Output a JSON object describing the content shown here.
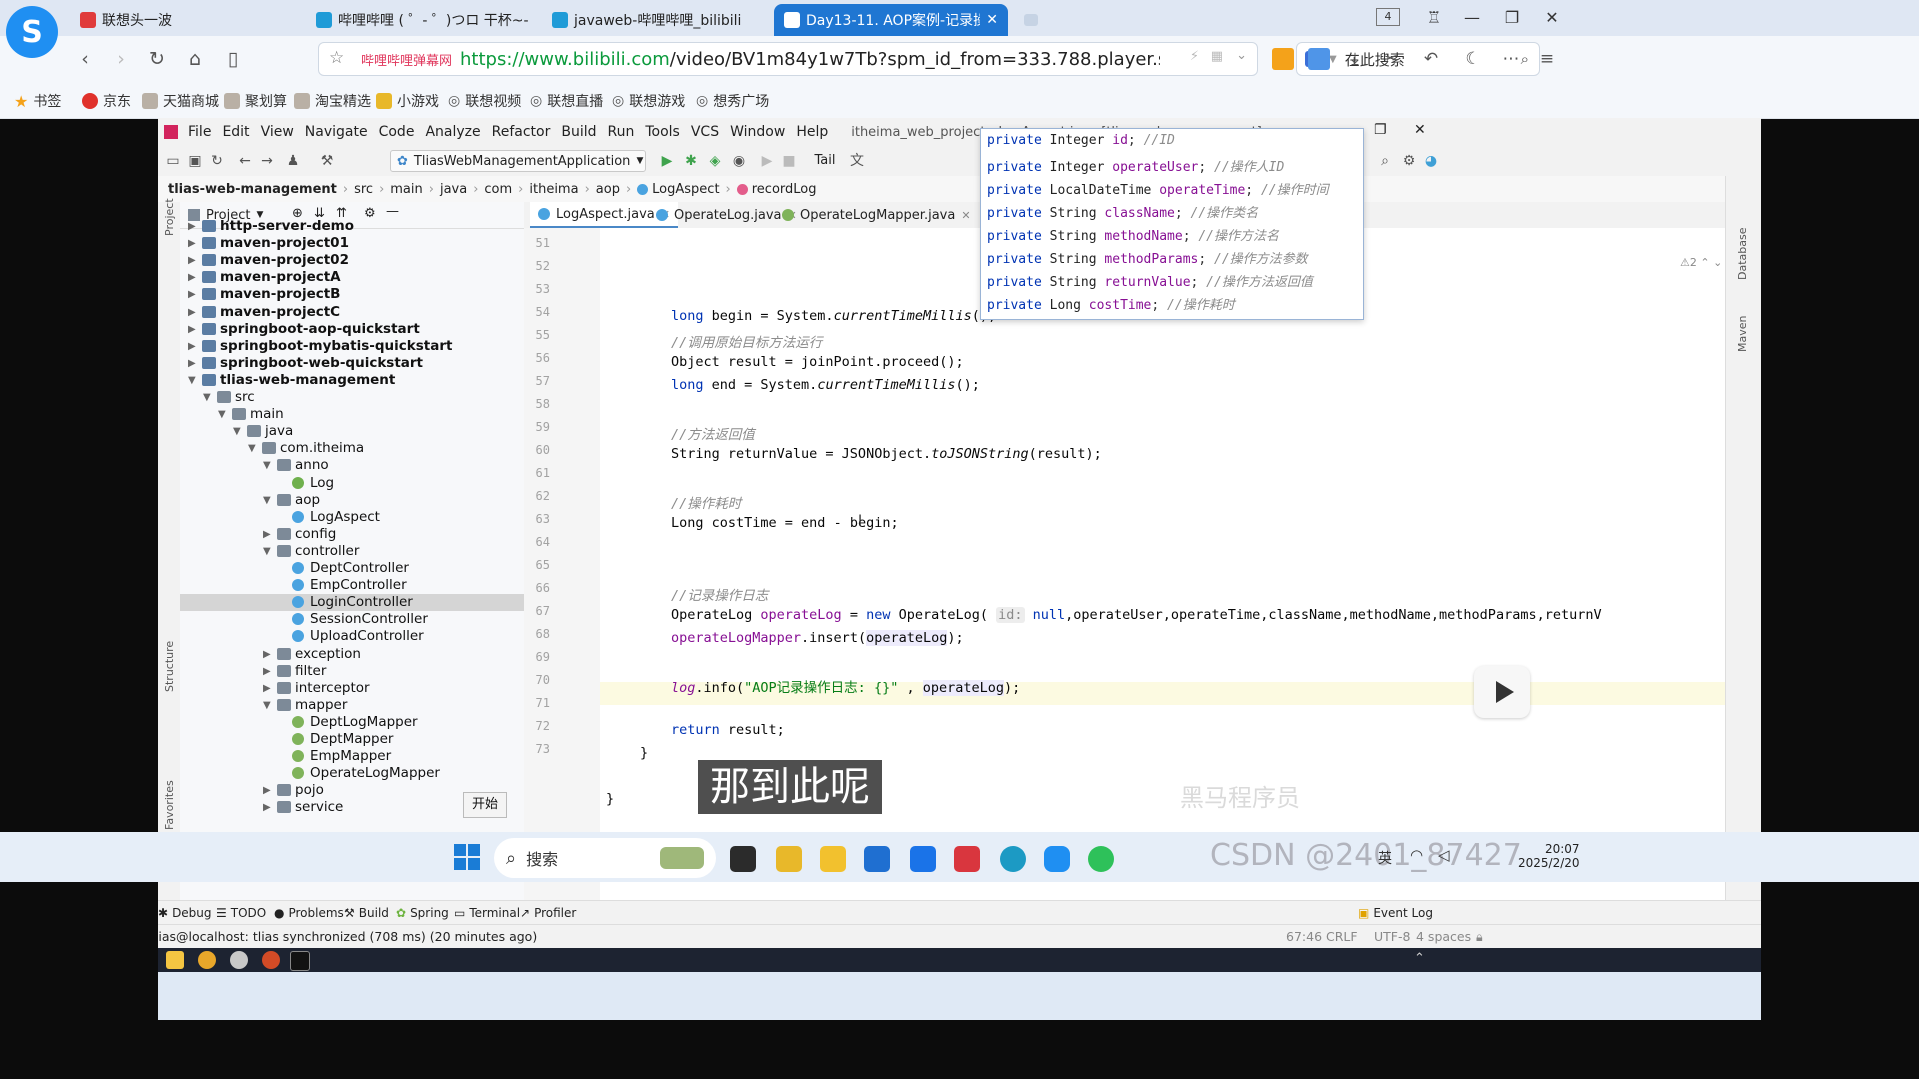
{
  "browser": {
    "tabs": [
      {
        "label": "联想头一波"
      },
      {
        "label": "哔哩哔哩 ( ゜- ゜)つロ 干杯~-bilib"
      },
      {
        "label": "javaweb-哔哩哔哩_bilibili"
      },
      {
        "label": "Day13-11. AOP案例-记录操作",
        "active": true
      }
    ],
    "tab_count": "4",
    "url_badge": "哔哩哔哩弹幕网",
    "url_scheme_host": "https://www.bilibili.com",
    "url_path": "/video/BV1m84y1w7Tb?spm_id_from=333.788.player.switcl",
    "search_placeholder": "在此搜索",
    "bookmarks": [
      "书签",
      "京东",
      "天猫商城",
      "聚划算",
      "淘宝精选",
      "小游戏",
      "联想视频",
      "联想直播",
      "联想游戏",
      "想秀广场"
    ]
  },
  "ide": {
    "menus": [
      "File",
      "Edit",
      "View",
      "Navigate",
      "Code",
      "Analyze",
      "Refactor",
      "Build",
      "Run",
      "Tools",
      "VCS",
      "Window",
      "Help"
    ],
    "window_title": "itheima_web_project - LogAspect.java [tlias-web-management]",
    "run_config": "TliasWebManagementApplication",
    "tail_label": "Tail",
    "breadcrumb": [
      "tlias-web-management",
      "src",
      "main",
      "java",
      "com",
      "itheima",
      "aop",
      "LogAspect",
      "recordLog"
    ],
    "project_label": "Project",
    "side_labels": {
      "project": "Project",
      "structure": "Structure",
      "favorites": "Favorites",
      "database": "Database",
      "maven": "Maven"
    },
    "tree": [
      {
        "label": "http-server-demo",
        "bold": true
      },
      {
        "label": "maven-project01",
        "bold": true
      },
      {
        "label": "maven-project02",
        "bold": true
      },
      {
        "label": "maven-projectA",
        "bold": true
      },
      {
        "label": "maven-projectB",
        "bold": true
      },
      {
        "label": "maven-projectC",
        "bold": true
      },
      {
        "label": "springboot-aop-quickstart",
        "bold": true
      },
      {
        "label": "springboot-mybatis-quickstart",
        "bold": true
      },
      {
        "label": "springboot-web-quickstart",
        "bold": true
      },
      {
        "label": "tlias-web-management",
        "bold": true
      },
      {
        "label": "src"
      },
      {
        "label": "main"
      },
      {
        "label": "java"
      },
      {
        "label": "com.itheima"
      },
      {
        "label": "anno"
      },
      {
        "label": "Log"
      },
      {
        "label": "aop"
      },
      {
        "label": "LogAspect"
      },
      {
        "label": "config"
      },
      {
        "label": "controller"
      },
      {
        "label": "DeptController"
      },
      {
        "label": "EmpController"
      },
      {
        "label": "LoginController"
      },
      {
        "label": "SessionController"
      },
      {
        "label": "UploadController"
      },
      {
        "label": "exception"
      },
      {
        "label": "filter"
      },
      {
        "label": "interceptor"
      },
      {
        "label": "mapper"
      },
      {
        "label": "DeptLogMapper"
      },
      {
        "label": "DeptMapper"
      },
      {
        "label": "EmpMapper"
      },
      {
        "label": "OperateLogMapper"
      },
      {
        "label": "pojo"
      },
      {
        "label": "service"
      }
    ],
    "editor_tabs": [
      "LogAspect.java",
      "OperateLog.java",
      "OperateLogMapper.java"
    ],
    "line_numbers": [
      "51",
      "52",
      "53",
      "54",
      "55",
      "56",
      "57",
      "58",
      "59",
      "60",
      "61",
      "62",
      "63",
      "64",
      "65",
      "66",
      "67",
      "68",
      "69",
      "70",
      "71",
      "72",
      "73"
    ],
    "code": {
      "l51": {
        "a": "long ",
        "b": "begin = System.",
        "c": "currentTimeMillis",
        "d": "();"
      },
      "l52": "//调用原始目标方法运行",
      "l53": "Object result = joinPoint.proceed();",
      "l54": {
        "a": "long ",
        "b": "end = System.",
        "c": "currentTimeMillis",
        "d": "();"
      },
      "l56": "//方法返回值",
      "l57": {
        "a": "String returnValue = JSONObject.",
        "b": "toJSONString",
        "c": "(result);"
      },
      "l59": "//操作耗时",
      "l60": {
        "a": "Long ",
        "b": "costTime = ",
        "c": "end",
        "d": " - ",
        "e": "begin;"
      },
      "l63": "//记录操作日志",
      "l64": {
        "a": "OperateLog ",
        "b": "operateLog",
        "c": " = ",
        "d": "new ",
        "e": "OperateLog( ",
        "f": "id:",
        "g": " null",
        "h": ",operateUser,operateTime,className,methodName,methodParams,returnV"
      },
      "l65": {
        "a": "operateLogMapper",
        "b": ".insert(",
        "c": "operateLog",
        "d": ");"
      },
      "l67": {
        "a": "log",
        "b": ".info(",
        "c": "\"AOP记录操作日志: {}\"",
        "d": " , ",
        "e": "operateLog",
        "f": ");"
      },
      "l69": {
        "a": "return ",
        "b": "result;"
      },
      "l70": "}",
      "l72": "}"
    },
    "warning_count": "2",
    "popup_lines": [
      {
        "kw": "private ",
        "type": "Integer ",
        "field": "id",
        "cm": "; //ID"
      },
      {
        "kw": "private ",
        "type": "Integer ",
        "field": "operateUser",
        "cm": "; //操作人ID"
      },
      {
        "kw": "private ",
        "type": "LocalDateTime ",
        "field": "operateTime",
        "cm": "; //操作时间"
      },
      {
        "kw": "private ",
        "type": "String ",
        "field": "className",
        "cm": "; //操作类名"
      },
      {
        "kw": "private ",
        "type": "String ",
        "field": "methodName",
        "cm": "; //操作方法名"
      },
      {
        "kw": "private ",
        "type": "String ",
        "field": "methodParams",
        "cm": "; //操作方法参数"
      },
      {
        "kw": "private ",
        "type": "String ",
        "field": "returnValue",
        "cm": "; //操作方法返回值"
      },
      {
        "kw": "private ",
        "type": "Long ",
        "field": "costTime",
        "cm": "; //操作耗时"
      }
    ],
    "bottom_tools": [
      "Debug",
      "TODO",
      "Problems",
      "Build",
      "Spring",
      "Terminal",
      "Profiler"
    ],
    "event_log": "Event Log",
    "status_text": "tlias@localhost: tlias synchronized (708 ms) (20 minutes ago)",
    "status_right": {
      "pos": "67:46",
      "eol": "CRLF",
      "enc": "UTF-8",
      "indent": "4 spaces"
    }
  },
  "overlay": {
    "subtitle": "那到此呢",
    "tooltip": "开始",
    "watermark_video": "黑马程序员",
    "watermark_csdn": "CSDN @2401_87427"
  },
  "taskbar": {
    "search_label": "搜索",
    "lang": "英",
    "time": "20:07",
    "date": "2025/2/20"
  }
}
